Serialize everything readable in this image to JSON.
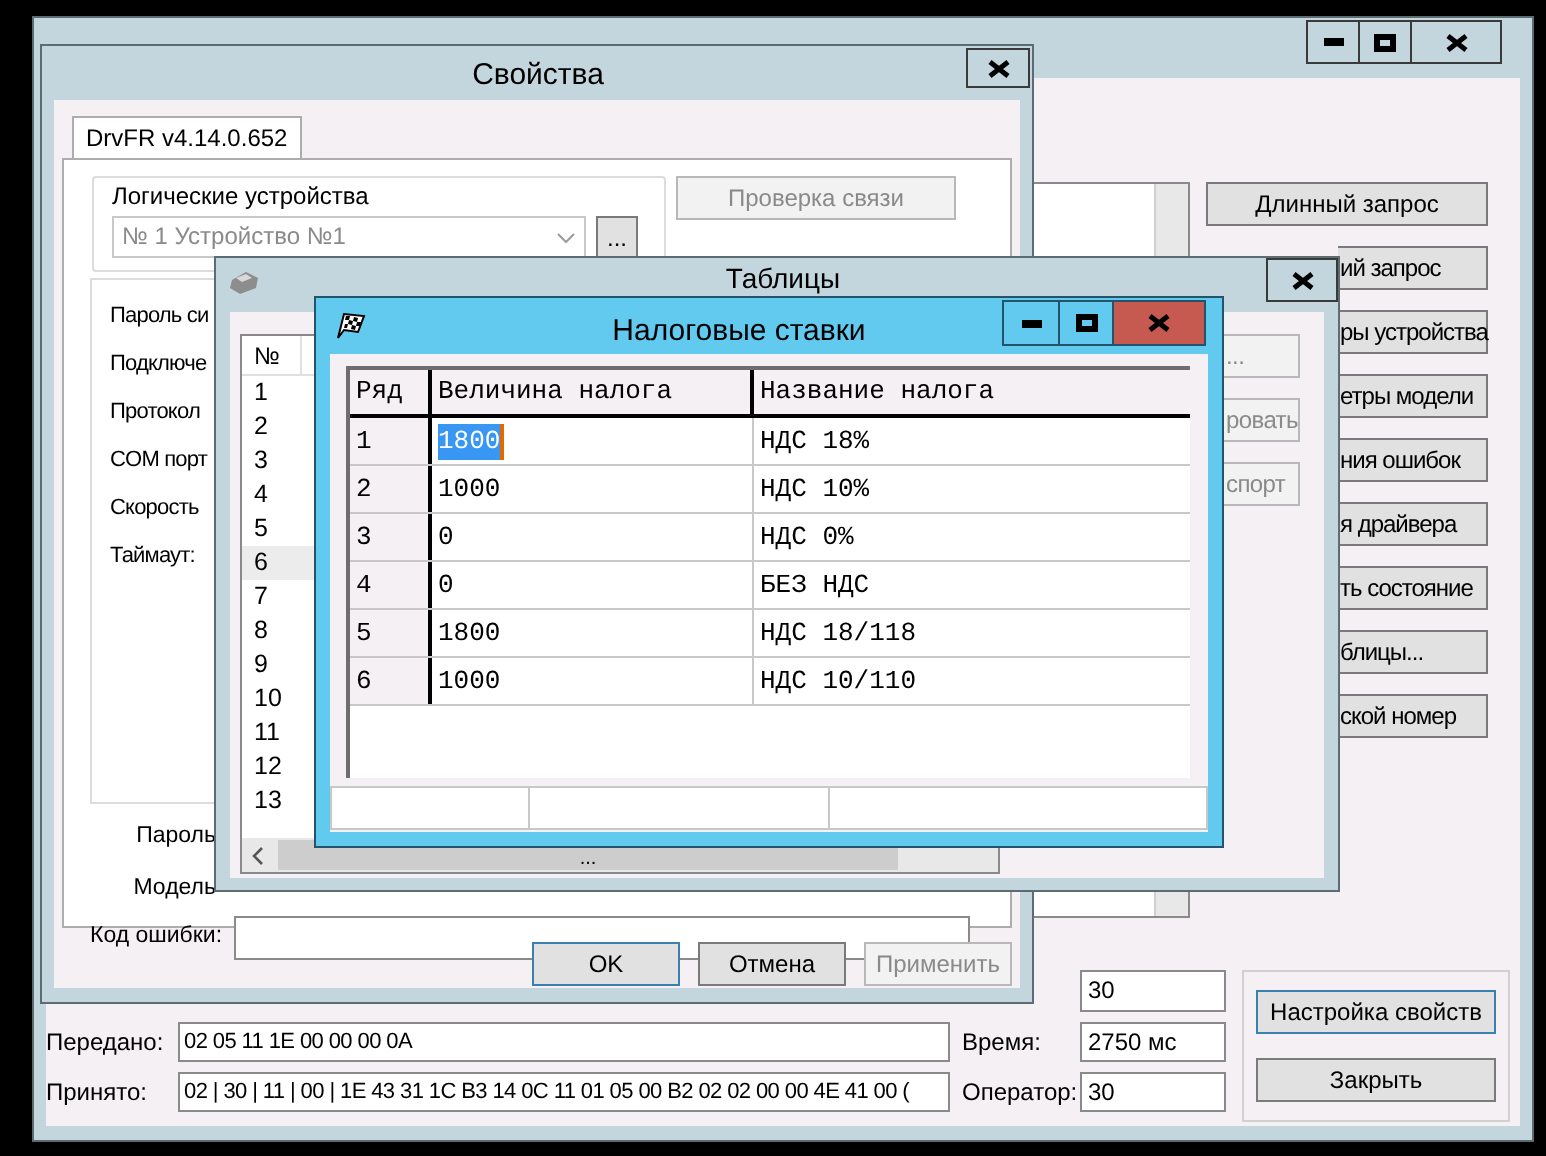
{
  "main_window": {
    "side_buttons": [
      {
        "label": "Длинный запрос",
        "kind": "full"
      },
      {
        "label": "ий запрос",
        "kind": "clipped"
      },
      {
        "label": "ры устройства",
        "kind": "clipped"
      },
      {
        "label": "етры модели",
        "kind": "clipped"
      },
      {
        "label": "ния ошибок",
        "kind": "clipped"
      },
      {
        "label": "я драйвера",
        "kind": "clipped"
      },
      {
        "label": "ть состояние",
        "kind": "clipped"
      },
      {
        "label": "блицы...",
        "kind": "clipped"
      },
      {
        "label": "ской номер",
        "kind": "clipped"
      }
    ],
    "top_field": "30",
    "sent_label": "Передано:",
    "sent": "02 05 11 1E 00 00 00 0A",
    "time_label": "Время:",
    "time": "2750 мс",
    "received_label": "Принято:",
    "received": "02 | 30 | 11 | 00 | 1E 43 31 1C B3 14 0C 11 01 05 00 B2 02 02 00 00 4E 41 00 (",
    "operator_label": "Оператор:",
    "operator": "30",
    "action_buttons": [
      {
        "label": "Настройка свойств",
        "focused": true
      },
      {
        "label": "Закрыть",
        "focused": false
      }
    ]
  },
  "properties_dialog": {
    "title": "Свойства",
    "tab": "DrvFR v4.14.0.652",
    "group_label": "Логические устройства",
    "device": "№ 1 Устройство №1",
    "browse": "...",
    "check_button": {
      "label": "Проверка связи",
      "disabled": true
    },
    "labels": [
      "Пароль си",
      "Подключе",
      "Протокол",
      "COM порт",
      "Скорость",
      "Таймаут:"
    ],
    "lower_labels": [
      "Пароль",
      "Модель"
    ],
    "error_label": "Код ошибки:",
    "buttons": [
      {
        "label": "OK",
        "focused": true,
        "disabled": false
      },
      {
        "label": "Отмена",
        "focused": false,
        "disabled": false
      },
      {
        "label": "Применить",
        "focused": false,
        "disabled": true
      }
    ]
  },
  "tables_window": {
    "title": "Таблицы",
    "list_header": "№",
    "rows": [
      {
        "label": "1",
        "selected": false
      },
      {
        "label": "2",
        "selected": false
      },
      {
        "label": "3",
        "selected": false
      },
      {
        "label": "4",
        "selected": false
      },
      {
        "label": "5",
        "selected": false
      },
      {
        "label": "6",
        "selected": true
      },
      {
        "label": "7",
        "selected": false
      },
      {
        "label": "8",
        "selected": false
      },
      {
        "label": "9",
        "selected": false
      },
      {
        "label": "10",
        "selected": false
      },
      {
        "label": "11",
        "selected": false
      },
      {
        "label": "12",
        "selected": false
      },
      {
        "label": "13",
        "selected": false
      }
    ],
    "scroll_thumb": "...",
    "side_buttons": [
      "...",
      "ровать",
      "спорт"
    ]
  },
  "tax_window": {
    "title": "Налоговые ставки",
    "columns": [
      "Ряд",
      "Величина налога",
      "Название налога"
    ],
    "rows": [
      {
        "row": "1",
        "value": "1800",
        "name": "НДС 18%",
        "selected": true
      },
      {
        "row": "2",
        "value": "1000",
        "name": "НДС 10%",
        "selected": false
      },
      {
        "row": "3",
        "value": "0",
        "name": "НДС 0%",
        "selected": false
      },
      {
        "row": "4",
        "value": "0",
        "name": "БЕЗ НДС",
        "selected": false
      },
      {
        "row": "5",
        "value": "1800",
        "name": "НДС 18/118",
        "selected": false
      },
      {
        "row": "6",
        "value": "1000",
        "name": "НДС 10/110",
        "selected": false
      }
    ]
  }
}
